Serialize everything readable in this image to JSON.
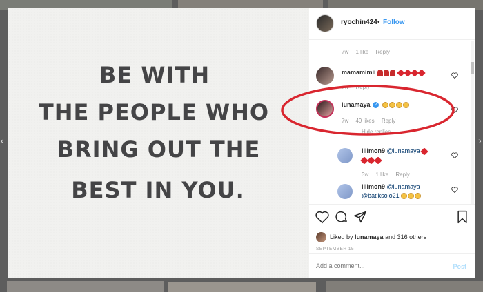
{
  "post": {
    "quote_lines": [
      "BE WITH",
      "THE PEOPLE WHO",
      "BRING OUT THE",
      "BEST IN YOU."
    ]
  },
  "header": {
    "username": "ryochin424",
    "separator": "•",
    "follow_label": "Follow"
  },
  "comments": [
    {
      "meta_time": "7w",
      "meta_likes": "1 like",
      "meta_reply": "Reply"
    },
    {
      "username": "mamamimii",
      "text": "",
      "meta_time": "7w",
      "meta_reply": "Reply"
    },
    {
      "username": "lunamaya",
      "verified": true,
      "meta_time": "7w",
      "meta_likes": "49 likes",
      "meta_reply": "Reply",
      "hide_replies": "Hide replies"
    },
    {
      "username": "lilimon9",
      "mention": "@lunamaya",
      "meta_time": "3w",
      "meta_likes": "1 like",
      "meta_reply": "Reply"
    },
    {
      "username": "lilimon9",
      "mention": "@lunamaya",
      "mention2": "@batiksolo21"
    }
  ],
  "footer": {
    "liked_by_prefix": "Liked by",
    "liked_by_user": "lunamaya",
    "liked_by_suffix": "and 316 others",
    "date": "SEPTEMBER 15",
    "comment_placeholder": "Add a comment...",
    "post_label": "Post"
  },
  "icons": [
    "heart-icon",
    "comment-icon",
    "share-icon",
    "bookmark-icon",
    "verified-icon",
    "small-heart-icon"
  ],
  "colors": {
    "accent": "#3897f0",
    "annotation": "#d9262f",
    "text": "#262626",
    "muted": "#999999"
  }
}
